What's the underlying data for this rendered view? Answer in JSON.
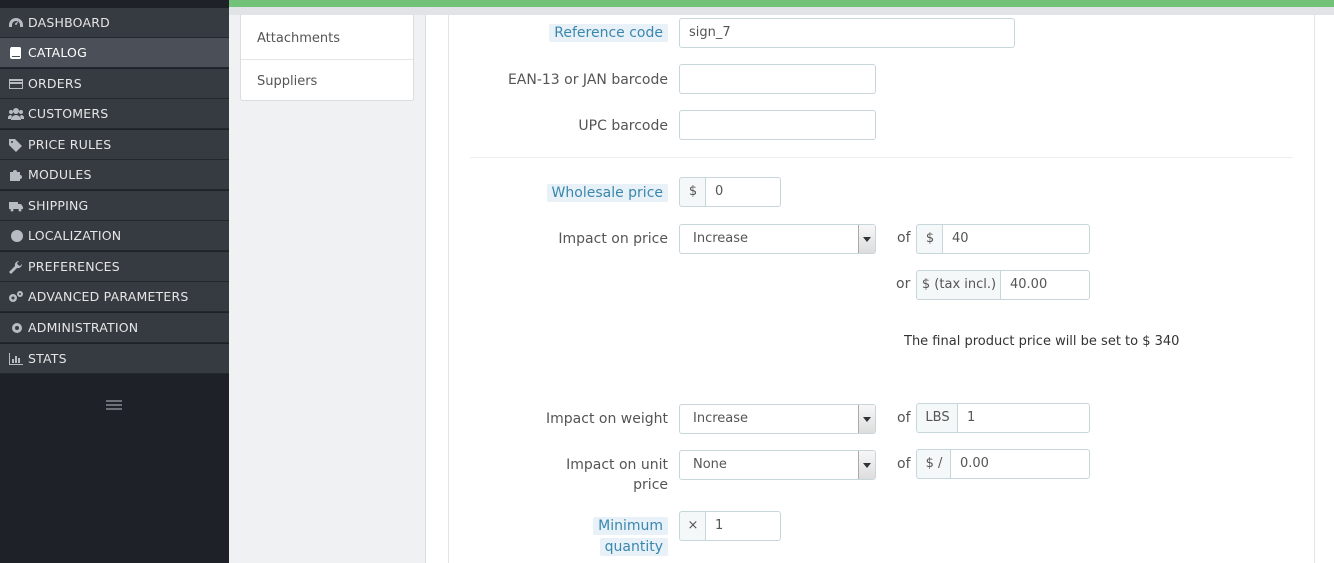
{
  "sidebar": {
    "items": [
      {
        "label": "Dashboard",
        "icon": "dashboard-icon"
      },
      {
        "label": "Catalog",
        "icon": "book-icon"
      },
      {
        "label": "Orders",
        "icon": "credit-card-icon"
      },
      {
        "label": "Customers",
        "icon": "users-icon"
      },
      {
        "label": "Price Rules",
        "icon": "tags-icon"
      },
      {
        "label": "Modules",
        "icon": "puzzle-icon"
      },
      {
        "label": "Shipping",
        "icon": "truck-icon"
      },
      {
        "label": "Localization",
        "icon": "globe-icon"
      },
      {
        "label": "Preferences",
        "icon": "wrench-icon"
      },
      {
        "label": "Advanced Parameters",
        "icon": "cogs-icon"
      },
      {
        "label": "Administration",
        "icon": "gear-icon"
      },
      {
        "label": "Stats",
        "icon": "bar-chart-icon"
      }
    ],
    "active_index": 1,
    "toggle_icon": "hamburger-icon"
  },
  "colors": {
    "accent_green": "#72c279",
    "sidebar_bg": "#1e2228",
    "label_highlight": "#3a87ad"
  },
  "tabs": {
    "attachments": "Attachments",
    "suppliers": "Suppliers"
  },
  "form": {
    "reference": {
      "label": "Reference code",
      "value": "sign_7"
    },
    "ean13": {
      "label": "EAN-13 or JAN barcode",
      "value": ""
    },
    "upc": {
      "label": "UPC barcode",
      "value": ""
    },
    "wholesale": {
      "label": "Wholesale price",
      "currency": "$",
      "value": "0"
    },
    "impact_price": {
      "label": "Impact on price",
      "selected": "Increase",
      "of_label": "of",
      "currency": "$",
      "value": "40",
      "or_label": "or",
      "tax_addon": "$ (tax incl.)",
      "tax_value": "40.00"
    },
    "final_price_note": "The final product price will be set to $ 340",
    "impact_weight": {
      "label": "Impact on weight",
      "selected": "Increase",
      "of_label": "of",
      "unit": "LBS",
      "value": "1"
    },
    "impact_unit_price": {
      "label_line1": "Impact on unit",
      "label_line2": "price",
      "selected": "None",
      "of_label": "of",
      "unit": "$ /",
      "value": "0.00"
    },
    "min_qty": {
      "label_line1": "Minimum",
      "label_line2": "quantity",
      "addon": "×",
      "value": "1"
    }
  }
}
